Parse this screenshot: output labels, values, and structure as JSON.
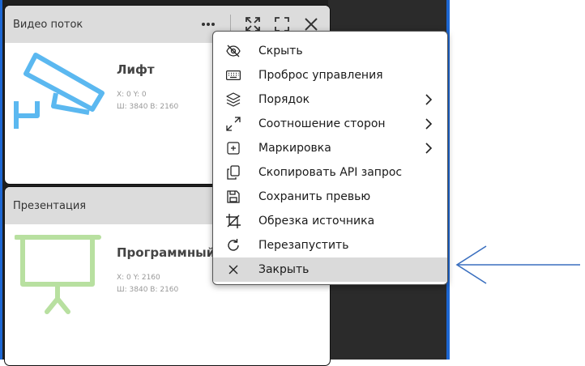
{
  "card1": {
    "title": "Видео поток",
    "source_name": "Лифт",
    "coords": "X: 0 Y: 0",
    "size": "Ш: 3840 В: 2160"
  },
  "card2": {
    "title": "Презентация",
    "source_name": "Программный и",
    "coords": "X: 0 Y: 2160",
    "size": "Ш: 3840 В: 2160"
  },
  "menu": {
    "items": [
      {
        "label": "Скрыть",
        "icon": "eye-off-icon"
      },
      {
        "label": "Проброс управления",
        "icon": "keyboard-icon"
      },
      {
        "label": "Порядок",
        "icon": "layers-icon",
        "submenu": true
      },
      {
        "label": "Соотношение сторон",
        "icon": "expand-diagonal-icon",
        "submenu": true
      },
      {
        "label": "Маркировка",
        "icon": "marking-grid-icon",
        "submenu": true
      },
      {
        "label": "Скопировать API запрос",
        "icon": "copy-icon"
      },
      {
        "label": "Сохранить превью",
        "icon": "save-icon"
      },
      {
        "label": "Обрезка источника",
        "icon": "crop-icon"
      },
      {
        "label": "Перезапустить",
        "icon": "restart-icon"
      },
      {
        "label": "Закрыть",
        "icon": "close-icon",
        "highlighted": true
      }
    ]
  },
  "colors": {
    "camera_icon": "#5bb8f0",
    "presentation_icon": "#b8e0a0",
    "highlight": "#dadada",
    "accent_border": "#1d67d3",
    "annotation_arrow": "#3a6fbf"
  }
}
